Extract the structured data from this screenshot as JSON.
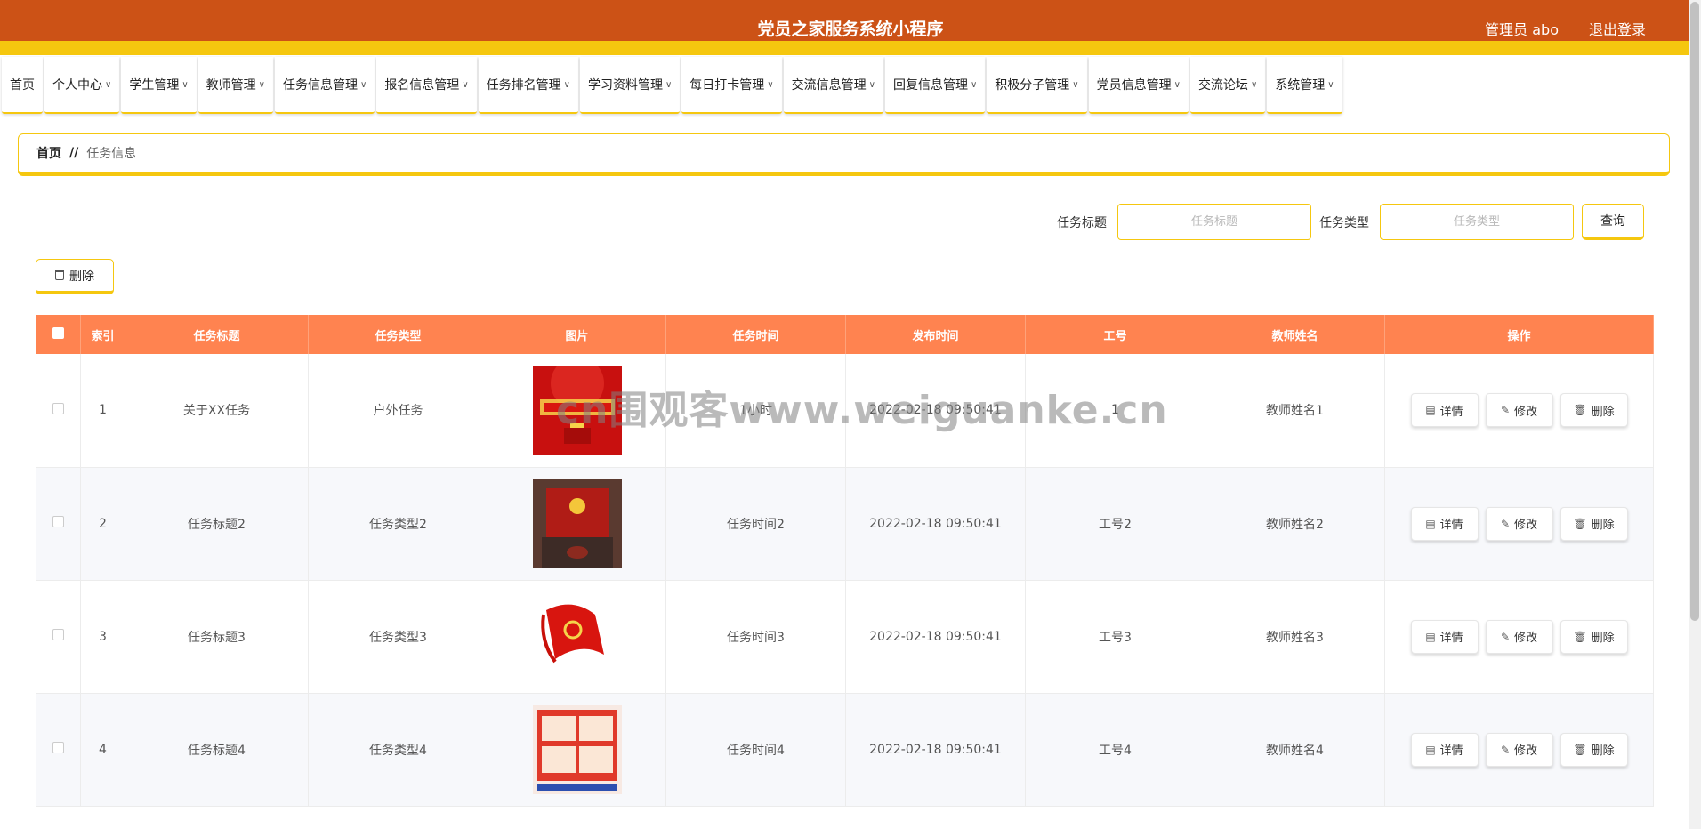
{
  "header": {
    "title": "党员之家服务系统小程序",
    "user": "管理员 abo",
    "logout": "退出登录"
  },
  "nav": [
    {
      "label": "首页",
      "dropdown": false
    },
    {
      "label": "个人中心",
      "dropdown": true
    },
    {
      "label": "学生管理",
      "dropdown": true
    },
    {
      "label": "教师管理",
      "dropdown": true
    },
    {
      "label": "任务信息管理",
      "dropdown": true
    },
    {
      "label": "报名信息管理",
      "dropdown": true
    },
    {
      "label": "任务排名管理",
      "dropdown": true
    },
    {
      "label": "学习资料管理",
      "dropdown": true
    },
    {
      "label": "每日打卡管理",
      "dropdown": true
    },
    {
      "label": "交流信息管理",
      "dropdown": true
    },
    {
      "label": "回复信息管理",
      "dropdown": true
    },
    {
      "label": "积极分子管理",
      "dropdown": true
    },
    {
      "label": "党员信息管理",
      "dropdown": true
    },
    {
      "label": "交流论坛",
      "dropdown": true
    },
    {
      "label": "系统管理",
      "dropdown": true
    }
  ],
  "breadcrumb": {
    "home": "首页",
    "separator": "//",
    "current": "任务信息"
  },
  "search": {
    "title_label": "任务标题",
    "title_placeholder": "任务标题",
    "type_label": "任务类型",
    "type_placeholder": "任务类型",
    "query_label": "查询"
  },
  "toolbar": {
    "delete_label": "删除"
  },
  "table": {
    "columns": [
      "",
      "索引",
      "任务标题",
      "任务类型",
      "图片",
      "任务时间",
      "发布时间",
      "工号",
      "教师姓名",
      "操作"
    ],
    "rows": [
      {
        "index": "1",
        "title": "关于XX任务",
        "type": "户外任务",
        "image": "party-banner-image",
        "time": "1小时",
        "published": "2022-02-18 09:50:41",
        "job_no": "1",
        "teacher": "教师姓名1"
      },
      {
        "index": "2",
        "title": "任务标题2",
        "type": "任务类型2",
        "image": "party-hall-image",
        "time": "任务时间2",
        "published": "2022-02-18 09:50:41",
        "job_no": "工号2",
        "teacher": "教师姓名2"
      },
      {
        "index": "3",
        "title": "任务标题3",
        "type": "任务类型3",
        "image": "party-flag-image",
        "time": "任务时间3",
        "published": "2022-02-18 09:50:41",
        "job_no": "工号3",
        "teacher": "教师姓名3"
      },
      {
        "index": "4",
        "title": "任务标题4",
        "type": "任务类型4",
        "image": "party-poster-image",
        "time": "任务时间4",
        "published": "2022-02-18 09:50:41",
        "job_no": "工号4",
        "teacher": "教师姓名4"
      }
    ],
    "actions": {
      "detail": "详情",
      "edit": "修改",
      "delete": "删除"
    }
  },
  "watermark": "cn围观客www.weiguanke.cn",
  "colors": {
    "header_bg": "#cc5216",
    "accent_yellow": "#f5c70f",
    "table_header": "#ff8350"
  }
}
